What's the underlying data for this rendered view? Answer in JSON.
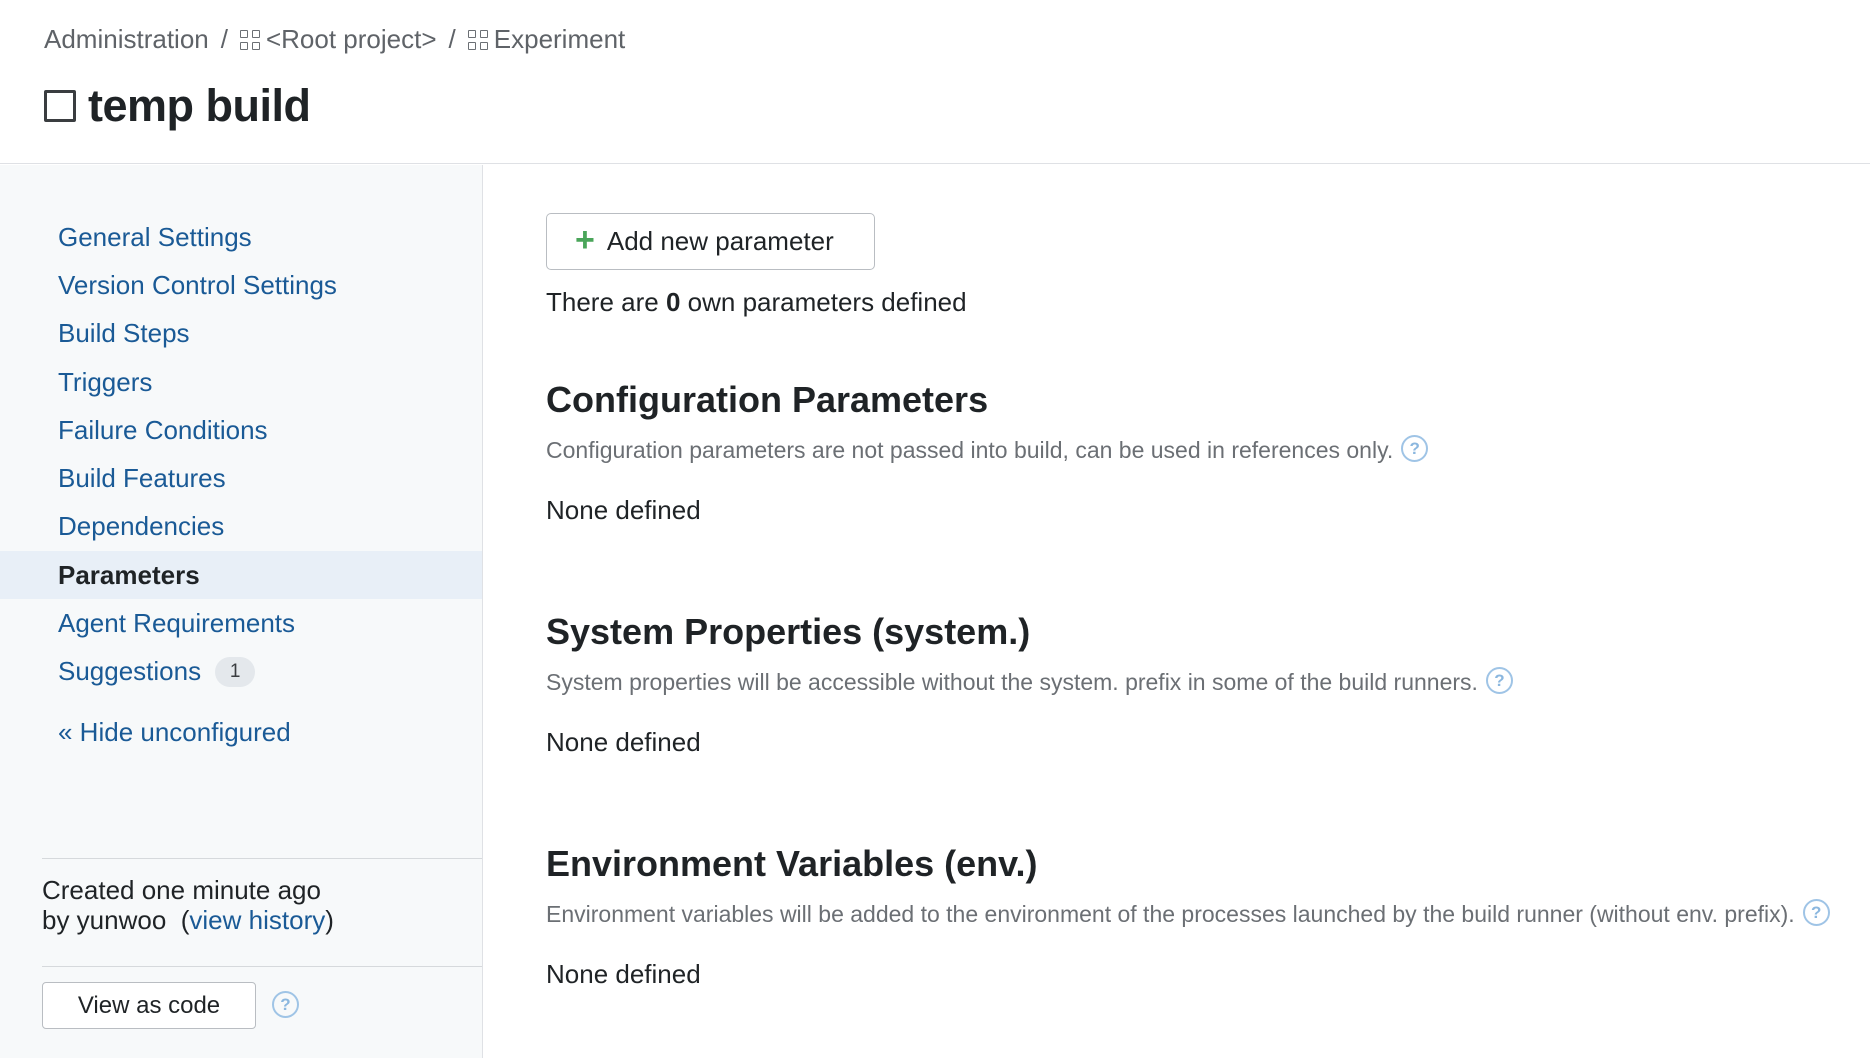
{
  "breadcrumb": {
    "items": [
      {
        "label": "Administration",
        "icon": ""
      },
      {
        "label": "<Root project>",
        "icon": "project-grid-icon"
      },
      {
        "label": "Experiment",
        "icon": "project-grid-icon"
      }
    ],
    "separator": "/"
  },
  "page": {
    "title": "temp build"
  },
  "sidebar": {
    "items": [
      {
        "label": "General Settings"
      },
      {
        "label": "Version Control Settings"
      },
      {
        "label": "Build Steps"
      },
      {
        "label": "Triggers"
      },
      {
        "label": "Failure Conditions"
      },
      {
        "label": "Build Features"
      },
      {
        "label": "Dependencies"
      },
      {
        "label": "Parameters",
        "active": true
      },
      {
        "label": "Agent Requirements"
      },
      {
        "label": "Suggestions",
        "badge": "1"
      }
    ],
    "hide_unconfigured": "« Hide unconfigured",
    "created": {
      "line1": "Created one minute ago",
      "by_prefix": "by yunwoo  (",
      "history_link": "view history",
      "by_suffix": ")"
    },
    "view_as_code": "View as code",
    "help_icon": "?"
  },
  "main": {
    "add_button": {
      "plus": "+",
      "label": "Add new parameter"
    },
    "own_count": {
      "prefix": "There are ",
      "count": "0",
      "suffix": " own parameters defined"
    },
    "sections": [
      {
        "title": "Configuration Parameters",
        "description": "Configuration parameters are not passed into build, can be used in references only.",
        "empty": "None defined"
      },
      {
        "title": "System Properties (system.)",
        "description": "System properties will be accessible without the system. prefix in some of the build runners.",
        "empty": "None defined"
      },
      {
        "title": "Environment Variables (env.)",
        "description": "Environment variables will be added to the environment of the processes launched by the build runner (without env. prefix).",
        "empty": "None defined"
      }
    ]
  },
  "colors": {
    "link": "#1a5a96",
    "active_bg": "#e8eff7",
    "sidebar_bg": "#f7f9fa",
    "plus": "#4aa55a",
    "help": "#8bb7df"
  }
}
